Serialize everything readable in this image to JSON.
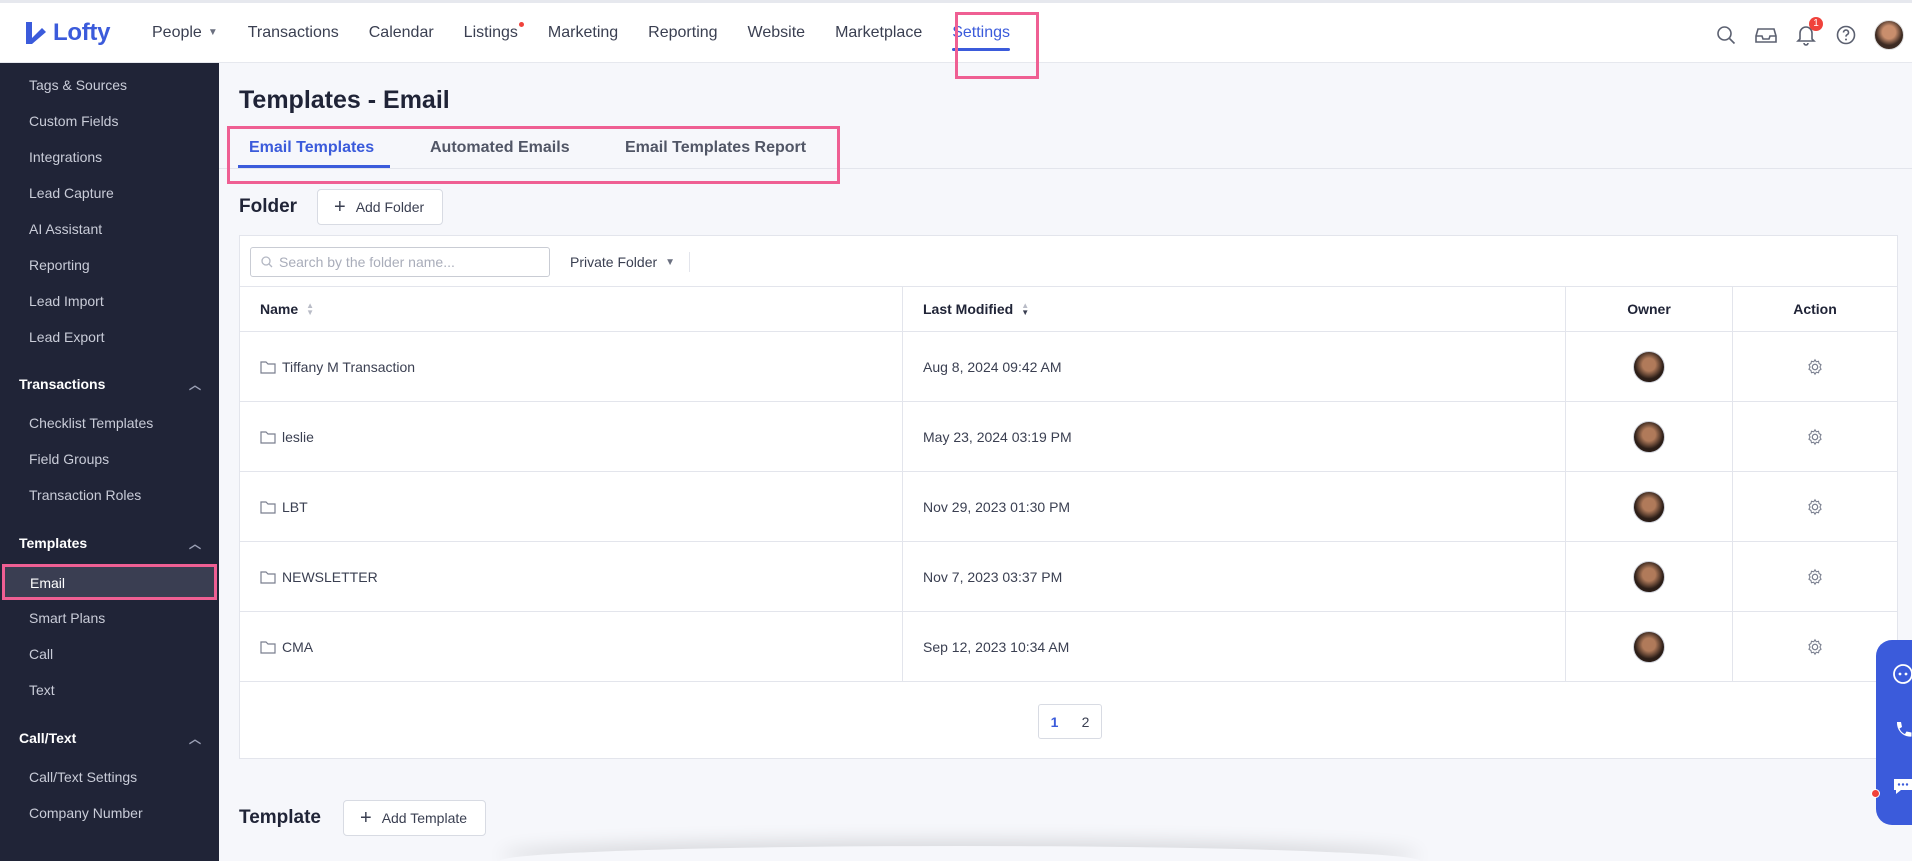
{
  "brand": {
    "name": "Lofty",
    "accent": "#3b5bdb",
    "highlight": "#ef5f93"
  },
  "topnav": {
    "items": [
      {
        "label": "People",
        "has_dropdown": true
      },
      {
        "label": "Transactions"
      },
      {
        "label": "Calendar"
      },
      {
        "label": "Listings",
        "has_dot": true
      },
      {
        "label": "Marketing"
      },
      {
        "label": "Reporting"
      },
      {
        "label": "Website"
      },
      {
        "label": "Marketplace"
      },
      {
        "label": "Settings",
        "active": true
      }
    ],
    "icons": [
      "search-icon",
      "inbox-icon",
      "bell-icon",
      "help-icon"
    ],
    "notification_count": "1"
  },
  "sidebar": {
    "items_top": [
      "Tags & Sources",
      "Custom Fields",
      "Integrations",
      "Lead Capture",
      "AI Assistant",
      "Reporting",
      "Lead Import",
      "Lead Export"
    ],
    "sections": [
      {
        "title": "Transactions",
        "items": [
          "Checklist Templates",
          "Field Groups",
          "Transaction Roles"
        ]
      },
      {
        "title": "Templates",
        "items": [
          "Email",
          "Smart Plans",
          "Call",
          "Text"
        ],
        "active_item": "Email"
      },
      {
        "title": "Call/Text",
        "items": [
          "Call/Text Settings",
          "Company Number"
        ]
      }
    ]
  },
  "page": {
    "title": "Templates - Email",
    "tabs": [
      "Email Templates",
      "Automated Emails",
      "Email Templates Report"
    ],
    "active_tab": "Email Templates"
  },
  "folder_section": {
    "label": "Folder",
    "add_button": "Add Folder",
    "search_placeholder": "Search by the folder name...",
    "filter_value": "Private Folder",
    "columns": {
      "name": "Name",
      "modified": "Last Modified",
      "owner": "Owner",
      "action": "Action"
    },
    "rows": [
      {
        "name": "Tiffany M Transaction",
        "modified": "Aug 8, 2024 09:42 AM"
      },
      {
        "name": "leslie",
        "modified": "May 23, 2024 03:19 PM"
      },
      {
        "name": "LBT",
        "modified": "Nov 29, 2023 01:30 PM"
      },
      {
        "name": "NEWSLETTER",
        "modified": "Nov 7, 2023 03:37 PM"
      },
      {
        "name": "CMA",
        "modified": "Sep 12, 2023 10:34 AM"
      }
    ],
    "pages": [
      "1",
      "2"
    ],
    "current_page": "1"
  },
  "template_section": {
    "label": "Template",
    "add_button": "Add Template"
  }
}
